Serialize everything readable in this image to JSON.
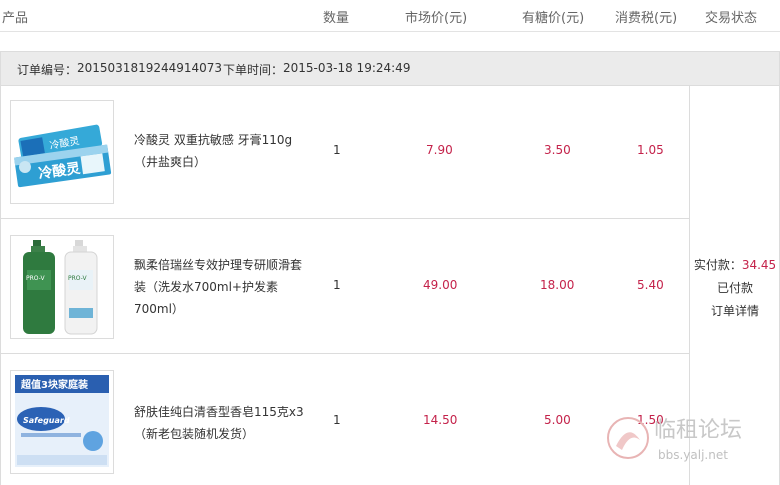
{
  "header": {
    "product": "产品",
    "qty": "数量",
    "market_price": "市场价(元)",
    "member_price": "有糖价(元)",
    "tax": "消费税(元)",
    "status": "交易状态"
  },
  "order": {
    "number_label": "订单编号：",
    "number": "2015031819244914073",
    "time_label": "下单时间：",
    "time": "2015-03-18 19:24:49"
  },
  "items": [
    {
      "name": "冷酸灵 双重抗敏感 牙膏110g （井盐爽白）",
      "qty": "1",
      "market": "7.90",
      "member": "3.50",
      "tax": "1.05",
      "image": "toothpaste-image"
    },
    {
      "name": "飘柔倍瑞丝专效护理专研顺滑套装（洗发水700ml+护发素700ml）",
      "qty": "1",
      "market": "49.00",
      "member": "18.00",
      "tax": "5.40",
      "image": "shampoo-set-image"
    },
    {
      "name": "舒肤佳纯白清香型香皂115克x3（新老包装随机发货）",
      "qty": "1",
      "market": "14.50",
      "member": "5.00",
      "tax": "1.50",
      "image": "soap-pack-image"
    }
  ],
  "payment": {
    "paid_label": "实付款：",
    "paid_amount": "34.45",
    "status": "已付款",
    "detail_link": "订单详情"
  },
  "product_text": {
    "toothpaste_brand": "冷酸灵",
    "soap_banner": "超值3块家庭装",
    "soap_brand": "Safeguard",
    "shampoo_brand": "PRO-V"
  },
  "watermark": {
    "name": "临租论坛",
    "url": "bbs.yalj.net"
  },
  "colors": {
    "price": "#c4224a",
    "order_bar": "#ebebeb",
    "border": "#dcdcdc"
  }
}
